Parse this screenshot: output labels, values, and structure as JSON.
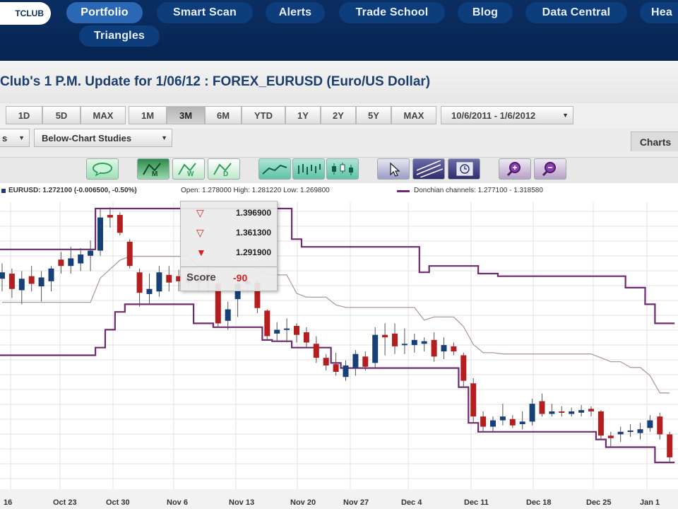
{
  "nav": {
    "logo_text": "TCLUB",
    "items": [
      {
        "label": "Portfolio",
        "active": true
      },
      {
        "label": "Smart Scan"
      },
      {
        "label": "Alerts"
      },
      {
        "label": "Trade School"
      },
      {
        "label": "Blog"
      },
      {
        "label": "Data Central"
      },
      {
        "label": "Hea"
      },
      {
        "label": "Triangles"
      }
    ]
  },
  "page_title": "Club's 1 P.M. Update for 1/06/12 : FOREX_EURUSD (Euro/US Dollar)",
  "toolbar": {
    "intraday_buttons": [
      "1D",
      "5D",
      "MAX"
    ],
    "range_buttons": [
      "1M",
      "3M",
      "6M",
      "YTD",
      "1Y",
      "2Y",
      "5Y",
      "MAX"
    ],
    "selected_range": "3M",
    "date_range": "10/6/2011 - 1/6/2012"
  },
  "studies": {
    "first_select": "s",
    "below_chart": "Below-Chart Studies",
    "charts_tab": "Charts"
  },
  "icons": [
    "speech-bubble-icon",
    "monthly-pattern-icon",
    "weekly-pattern-icon",
    "daily-pattern-icon",
    "line-chart-icon",
    "bar-chart-icon",
    "candlestick-chart-icon",
    "pointer-icon",
    "trendline-icon",
    "clock-icon",
    "zoom-in-icon",
    "zoom-out-icon"
  ],
  "legend": {
    "symbol": "EURUSD: 1.272100 (-0.006500, -0.50%)",
    "ohlc": "Open: 1.278000  High: 1.281220  Low: 1.269800",
    "donchian": "Donchian channels: 1.277100 - 1.318580"
  },
  "popup": {
    "targets": [
      "1.396900",
      "1.361300",
      "1.291900"
    ],
    "score_label": "Score",
    "score_value": "-90"
  },
  "colors": {
    "nav_bg": "#0b2e63",
    "up_candle": "#173f78",
    "down_candle": "#b51e1e",
    "donchian": "#6e2a6e",
    "midline": "#b09aa8"
  },
  "chart_data": {
    "type": "candlestick",
    "x_labels": [
      "16",
      "Oct 23",
      "Oct 30",
      "Nov 6",
      "Nov 13",
      "Nov 20",
      "Nov 27",
      "Dec 4",
      "Dec 11",
      "Dec 18",
      "Dec 25",
      "Jan 1"
    ],
    "grid": true,
    "candles": [
      {
        "o": 1.37,
        "h": 1.382,
        "l": 1.36,
        "c": 1.375
      },
      {
        "o": 1.374,
        "h": 1.378,
        "l": 1.355,
        "c": 1.362
      },
      {
        "o": 1.361,
        "h": 1.376,
        "l": 1.35,
        "c": 1.37
      },
      {
        "o": 1.372,
        "h": 1.38,
        "l": 1.36,
        "c": 1.366
      },
      {
        "o": 1.364,
        "h": 1.376,
        "l": 1.352,
        "c": 1.371
      },
      {
        "o": 1.368,
        "h": 1.38,
        "l": 1.36,
        "c": 1.378
      },
      {
        "o": 1.385,
        "h": 1.391,
        "l": 1.374,
        "c": 1.38
      },
      {
        "o": 1.38,
        "h": 1.395,
        "l": 1.374,
        "c": 1.386
      },
      {
        "o": 1.382,
        "h": 1.394,
        "l": 1.376,
        "c": 1.389
      },
      {
        "o": 1.388,
        "h": 1.4,
        "l": 1.376,
        "c": 1.392
      },
      {
        "o": 1.392,
        "h": 1.425,
        "l": 1.388,
        "c": 1.418
      },
      {
        "o": 1.42,
        "h": 1.426,
        "l": 1.41,
        "c": 1.418
      },
      {
        "o": 1.42,
        "h": 1.422,
        "l": 1.404,
        "c": 1.406
      },
      {
        "o": 1.399,
        "h": 1.401,
        "l": 1.378,
        "c": 1.38
      },
      {
        "o": 1.375,
        "h": 1.378,
        "l": 1.348,
        "c": 1.359
      },
      {
        "o": 1.358,
        "h": 1.374,
        "l": 1.35,
        "c": 1.362
      },
      {
        "o": 1.36,
        "h": 1.38,
        "l": 1.356,
        "c": 1.375
      },
      {
        "o": 1.373,
        "h": 1.38,
        "l": 1.36,
        "c": 1.367
      },
      {
        "o": 1.372,
        "h": 1.377,
        "l": 1.36,
        "c": 1.368
      },
      {
        "o": 1.372,
        "h": 1.376,
        "l": 1.364,
        "c": 1.367
      },
      {
        "o": 1.372,
        "h": 1.376,
        "l": 1.36,
        "c": 1.367
      },
      {
        "o": 1.374,
        "h": 1.379,
        "l": 1.36,
        "c": 1.368
      },
      {
        "o": 1.366,
        "h": 1.372,
        "l": 1.332,
        "c": 1.335
      },
      {
        "o": 1.337,
        "h": 1.352,
        "l": 1.33,
        "c": 1.346
      },
      {
        "o": 1.354,
        "h": 1.372,
        "l": 1.34,
        "c": 1.366
      },
      {
        "o": 1.366,
        "h": 1.372,
        "l": 1.36,
        "c": 1.368
      },
      {
        "o": 1.367,
        "h": 1.369,
        "l": 1.343,
        "c": 1.347
      },
      {
        "o": 1.345,
        "h": 1.346,
        "l": 1.322,
        "c": 1.325
      },
      {
        "o": 1.327,
        "h": 1.336,
        "l": 1.321,
        "c": 1.33
      },
      {
        "o": 1.33,
        "h": 1.339,
        "l": 1.32,
        "c": 1.331
      },
      {
        "o": 1.333,
        "h": 1.335,
        "l": 1.32,
        "c": 1.326
      },
      {
        "o": 1.328,
        "h": 1.332,
        "l": 1.316,
        "c": 1.32
      },
      {
        "o": 1.319,
        "h": 1.325,
        "l": 1.304,
        "c": 1.308
      },
      {
        "o": 1.308,
        "h": 1.311,
        "l": 1.298,
        "c": 1.302
      },
      {
        "o": 1.303,
        "h": 1.312,
        "l": 1.294,
        "c": 1.297
      },
      {
        "o": 1.293,
        "h": 1.306,
        "l": 1.29,
        "c": 1.302
      },
      {
        "o": 1.3,
        "h": 1.314,
        "l": 1.294,
        "c": 1.311
      },
      {
        "o": 1.309,
        "h": 1.313,
        "l": 1.298,
        "c": 1.301
      },
      {
        "o": 1.304,
        "h": 1.332,
        "l": 1.3,
        "c": 1.326
      },
      {
        "o": 1.326,
        "h": 1.335,
        "l": 1.31,
        "c": 1.324
      },
      {
        "o": 1.327,
        "h": 1.335,
        "l": 1.311,
        "c": 1.317
      },
      {
        "o": 1.318,
        "h": 1.331,
        "l": 1.311,
        "c": 1.319
      },
      {
        "o": 1.318,
        "h": 1.327,
        "l": 1.312,
        "c": 1.322
      },
      {
        "o": 1.319,
        "h": 1.324,
        "l": 1.313,
        "c": 1.321
      },
      {
        "o": 1.322,
        "h": 1.328,
        "l": 1.305,
        "c": 1.309
      },
      {
        "o": 1.313,
        "h": 1.324,
        "l": 1.307,
        "c": 1.318
      },
      {
        "o": 1.317,
        "h": 1.32,
        "l": 1.31,
        "c": 1.313
      },
      {
        "o": 1.31,
        "h": 1.312,
        "l": 1.285,
        "c": 1.29
      },
      {
        "o": 1.288,
        "h": 1.292,
        "l": 1.257,
        "c": 1.262
      },
      {
        "o": 1.262,
        "h": 1.266,
        "l": 1.25,
        "c": 1.254
      },
      {
        "o": 1.254,
        "h": 1.262,
        "l": 1.25,
        "c": 1.259
      },
      {
        "o": 1.259,
        "h": 1.272,
        "l": 1.255,
        "c": 1.262
      },
      {
        "o": 1.26,
        "h": 1.263,
        "l": 1.253,
        "c": 1.255
      },
      {
        "o": 1.256,
        "h": 1.266,
        "l": 1.252,
        "c": 1.258
      },
      {
        "o": 1.258,
        "h": 1.276,
        "l": 1.255,
        "c": 1.272
      },
      {
        "o": 1.274,
        "h": 1.28,
        "l": 1.262,
        "c": 1.264
      },
      {
        "o": 1.264,
        "h": 1.272,
        "l": 1.262,
        "c": 1.266
      },
      {
        "o": 1.266,
        "h": 1.27,
        "l": 1.262,
        "c": 1.265
      },
      {
        "o": 1.264,
        "h": 1.269,
        "l": 1.262,
        "c": 1.266
      },
      {
        "o": 1.265,
        "h": 1.271,
        "l": 1.262,
        "c": 1.267
      },
      {
        "o": 1.268,
        "h": 1.27,
        "l": 1.262,
        "c": 1.266
      },
      {
        "o": 1.266,
        "h": 1.267,
        "l": 1.244,
        "c": 1.247
      },
      {
        "o": 1.247,
        "h": 1.25,
        "l": 1.238,
        "c": 1.245
      },
      {
        "o": 1.248,
        "h": 1.254,
        "l": 1.242,
        "c": 1.25
      },
      {
        "o": 1.25,
        "h": 1.256,
        "l": 1.246,
        "c": 1.251
      },
      {
        "o": 1.249,
        "h": 1.257,
        "l": 1.244,
        "c": 1.252
      },
      {
        "o": 1.253,
        "h": 1.263,
        "l": 1.25,
        "c": 1.259
      },
      {
        "o": 1.262,
        "h": 1.265,
        "l": 1.244,
        "c": 1.248
      },
      {
        "o": 1.248,
        "h": 1.25,
        "l": 1.226,
        "c": 1.23
      }
    ],
    "donchian_upper": [
      1.393,
      1.393,
      1.393,
      1.393,
      1.393,
      1.393,
      1.393,
      1.393,
      1.393,
      1.393,
      1.425,
      1.425,
      1.425,
      1.425,
      1.425,
      1.425,
      1.425,
      1.425,
      1.425,
      1.425,
      1.425,
      1.425,
      1.425,
      1.425,
      1.425,
      1.425,
      1.425,
      1.425,
      1.425,
      1.425,
      1.401,
      1.395,
      1.395,
      1.395,
      1.395,
      1.395,
      1.395,
      1.395,
      1.395,
      1.395,
      1.395,
      1.395,
      1.395,
      1.375,
      1.38,
      1.38,
      1.38,
      1.38,
      1.38,
      1.374,
      1.374,
      1.372,
      1.372,
      1.372,
      1.372,
      1.372,
      1.372,
      1.372,
      1.372,
      1.372,
      1.372,
      1.372,
      1.372,
      1.372,
      1.363,
      1.363,
      1.35,
      1.335,
      1.335
    ],
    "donchian_lower": [
      1.31,
      1.31,
      1.31,
      1.31,
      1.31,
      1.31,
      1.31,
      1.31,
      1.31,
      1.31,
      1.316,
      1.33,
      1.344,
      1.35,
      1.35,
      1.35,
      1.35,
      1.35,
      1.35,
      1.35,
      1.335,
      1.335,
      1.332,
      1.332,
      1.332,
      1.332,
      1.332,
      1.322,
      1.321,
      1.321,
      1.316,
      1.316,
      1.316,
      1.316,
      1.304,
      1.3,
      1.3,
      1.3,
      1.3,
      1.3,
      1.3,
      1.3,
      1.3,
      1.3,
      1.3,
      1.3,
      1.3,
      1.285,
      1.257,
      1.25,
      1.25,
      1.25,
      1.25,
      1.25,
      1.25,
      1.25,
      1.25,
      1.25,
      1.25,
      1.25,
      1.25,
      1.244,
      1.238,
      1.238,
      1.238,
      1.238,
      1.238,
      1.226,
      1.226
    ]
  },
  "chart_axes": {
    "y_min": 1.205,
    "y_max": 1.43
  }
}
